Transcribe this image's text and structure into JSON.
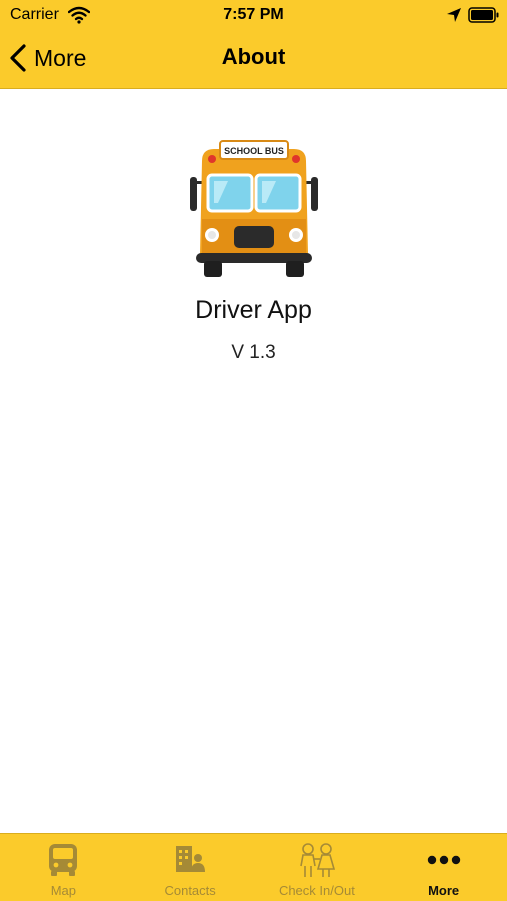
{
  "status_bar": {
    "carrier": "Carrier",
    "time": "7:57 PM"
  },
  "nav": {
    "back_label": "More",
    "title": "About"
  },
  "about": {
    "logo_text": "SCHOOL BUS",
    "app_name": "Driver App",
    "version": "V 1.3"
  },
  "tabs": [
    {
      "label": "Map",
      "icon": "bus-icon",
      "active": false
    },
    {
      "label": "Contacts",
      "icon": "contacts-icon",
      "active": false
    },
    {
      "label": "Check In/Out",
      "icon": "children-icon",
      "active": false
    },
    {
      "label": "More",
      "icon": "more-icon",
      "active": true
    }
  ],
  "colors": {
    "accent": "#fbcb2b",
    "inactive_tab": "#a58a36",
    "active_tab": "#111111"
  }
}
